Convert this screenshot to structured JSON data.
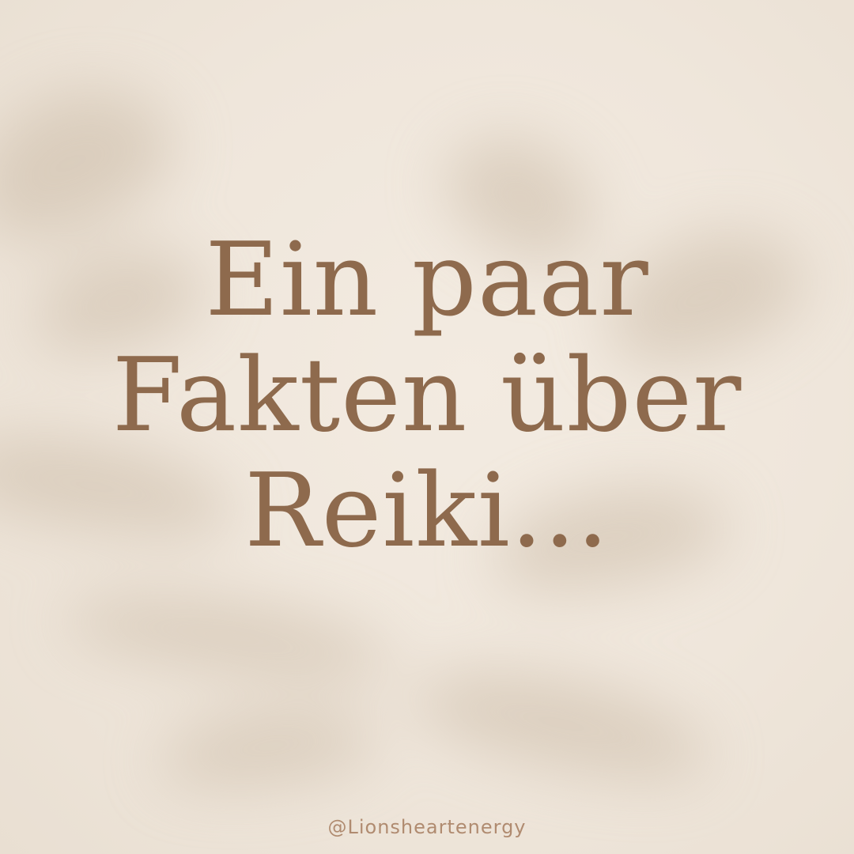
{
  "headline": {
    "line1": "Ein paar",
    "line2": "Fakten über",
    "line3": "Reiki..."
  },
  "footer": {
    "handle": "@Lionsheartenergy"
  },
  "colors": {
    "background": "#efe6db",
    "text": "#8e6a4d",
    "handle": "#b08b70",
    "shadow": "#cbbba7"
  }
}
